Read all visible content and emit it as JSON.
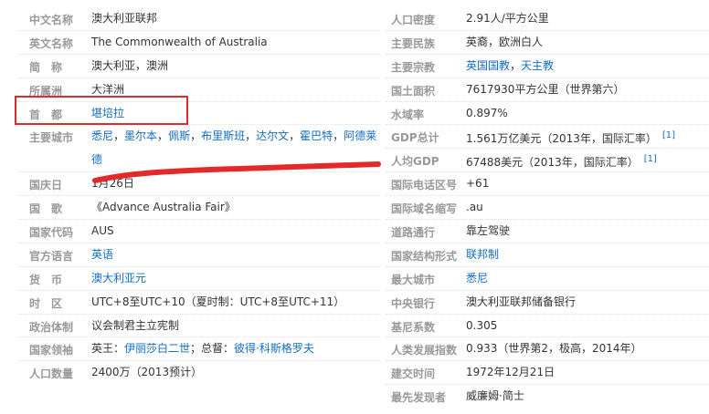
{
  "left": [
    {
      "label": "中文名称",
      "parts": [
        {
          "t": "澳大利亚联邦"
        }
      ]
    },
    {
      "label": "英文名称",
      "parts": [
        {
          "t": "The Commonwealth of Australia"
        }
      ]
    },
    {
      "label": "简　称",
      "parts": [
        {
          "t": "澳大利亚，澳洲"
        }
      ]
    },
    {
      "label": "所属洲",
      "parts": [
        {
          "t": "大洋洲"
        }
      ]
    },
    {
      "label": "首　都",
      "parts": [
        {
          "t": "堪培拉",
          "link": true
        }
      ]
    },
    {
      "label": "主要城市",
      "parts": [
        {
          "t": "悉尼",
          "link": true
        },
        {
          "t": "，"
        },
        {
          "t": "墨尔本",
          "link": true
        },
        {
          "t": "，"
        },
        {
          "t": "佩斯",
          "link": true
        },
        {
          "t": "，"
        },
        {
          "t": "布里斯班",
          "link": true
        },
        {
          "t": "，"
        },
        {
          "t": "达尔文",
          "link": true
        },
        {
          "t": "，"
        },
        {
          "t": "霍巴特",
          "link": true
        },
        {
          "t": "，"
        },
        {
          "t": "阿德莱德",
          "link": true
        }
      ],
      "tall": true
    },
    {
      "label": "国庆日",
      "parts": [
        {
          "t": "1月26日"
        }
      ]
    },
    {
      "label": "国　歌",
      "parts": [
        {
          "t": "《Advance Australia Fair》"
        }
      ]
    },
    {
      "label": "国家代码",
      "parts": [
        {
          "t": "AUS"
        }
      ]
    },
    {
      "label": "官方语言",
      "parts": [
        {
          "t": "英语",
          "link": true
        }
      ]
    },
    {
      "label": "货　币",
      "parts": [
        {
          "t": "澳大利亚元",
          "link": true
        }
      ]
    },
    {
      "label": "时　区",
      "parts": [
        {
          "t": "UTC+8至UTC+10（夏时制：UTC+8至UTC+11）"
        }
      ]
    },
    {
      "label": "政治体制",
      "parts": [
        {
          "t": "议会制君主立宪制"
        }
      ]
    },
    {
      "label": "国家领袖",
      "parts": [
        {
          "t": "英王："
        },
        {
          "t": "伊丽莎白二世",
          "link": true
        },
        {
          "t": "；总督："
        },
        {
          "t": "彼得·科斯格罗夫",
          "link": true
        }
      ]
    },
    {
      "label": "人口数量",
      "parts": [
        {
          "t": "2400万（2013预计）"
        }
      ]
    }
  ],
  "right": [
    {
      "label": "人口密度",
      "parts": [
        {
          "t": "2.91人/平方公里"
        }
      ]
    },
    {
      "label": "主要民族",
      "parts": [
        {
          "t": "英裔，欧洲白人"
        }
      ]
    },
    {
      "label": "主要宗教",
      "parts": [
        {
          "t": "英国国教",
          "link": true
        },
        {
          "t": "，"
        },
        {
          "t": "天主教",
          "link": true
        }
      ]
    },
    {
      "label": "国土面积",
      "parts": [
        {
          "t": "7617930平方公里（世界第六）"
        }
      ]
    },
    {
      "label": "水域率",
      "parts": [
        {
          "t": "0.897%"
        }
      ]
    },
    {
      "label": "GDP总计",
      "parts": [
        {
          "t": "1.561万亿美元（2013年，国际汇率）"
        },
        {
          "t": "[1]",
          "ref": true
        }
      ]
    },
    {
      "label": "人均GDP",
      "parts": [
        {
          "t": "67488美元（2013年，国际汇率）"
        },
        {
          "t": "[1]",
          "ref": true
        }
      ]
    },
    {
      "label": "国际电话区号",
      "parts": [
        {
          "t": "+61"
        }
      ]
    },
    {
      "label": "国际域名缩写",
      "parts": [
        {
          "t": ".au"
        }
      ]
    },
    {
      "label": "道路通行",
      "parts": [
        {
          "t": "靠左驾驶"
        }
      ]
    },
    {
      "label": "国家结构形式",
      "parts": [
        {
          "t": "联邦制",
          "link": true
        }
      ]
    },
    {
      "label": "最大城市",
      "parts": [
        {
          "t": "悉尼",
          "link": true
        }
      ]
    },
    {
      "label": "中央银行",
      "parts": [
        {
          "t": "澳大利亚联邦储备银行"
        }
      ]
    },
    {
      "label": "基尼系数",
      "parts": [
        {
          "t": "0.305"
        }
      ]
    },
    {
      "label": "人类发展指数",
      "parts": [
        {
          "t": "0.933（世界第2，极高，2014年）"
        }
      ]
    },
    {
      "label": "建交时间",
      "parts": [
        {
          "t": "1972年12月21日"
        }
      ]
    },
    {
      "label": "最先发现者",
      "parts": [
        {
          "t": "威廉姆·简士"
        }
      ]
    }
  ],
  "colors": {
    "label": "#999999",
    "link": "#136ec2",
    "annotation": "#e32a2a"
  }
}
